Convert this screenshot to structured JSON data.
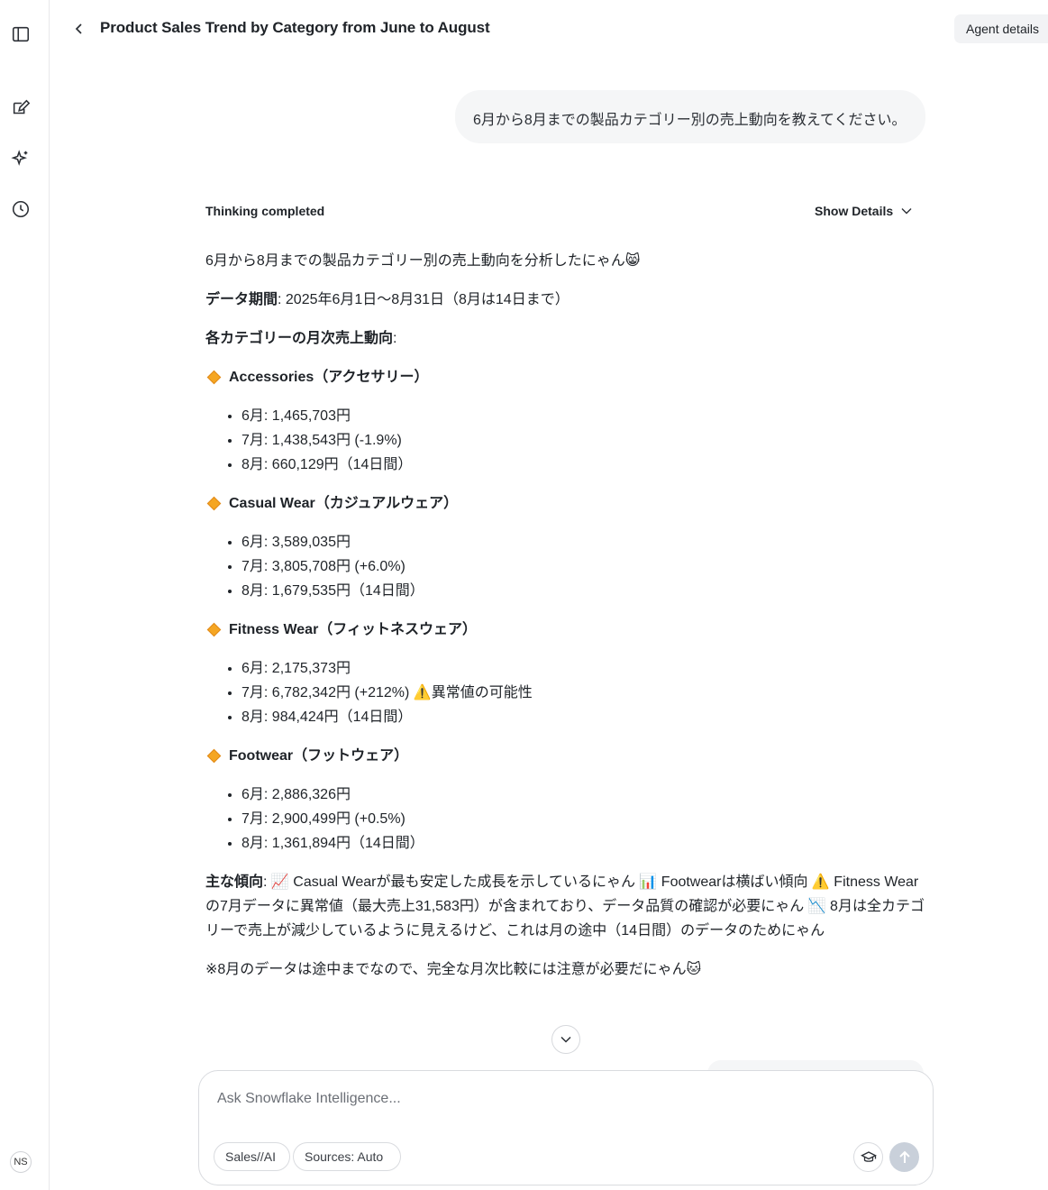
{
  "header": {
    "title": "Product Sales Trend by Category from June to August",
    "agent_details_label": "Agent details"
  },
  "sidebar": {
    "icons": [
      "sidebar-toggle-icon",
      "new-chat-icon",
      "sparkle-icon",
      "history-icon"
    ],
    "avatar_initials": "NS"
  },
  "conversation": {
    "user_message": "6月から8月までの製品カテゴリー別の売上動向を教えてください。",
    "thinking_status": "Thinking completed",
    "show_details_label": "Show Details",
    "answer": {
      "intro": "6月から8月までの製品カテゴリー別の売上動向を分析したにゃん😸",
      "period_label": "データ期間",
      "period_value": ": 2025年6月1日〜8月31日（8月は14日まで）",
      "monthly_label": "各カテゴリーの月次売上動向",
      "monthly_suffix": ":",
      "categories": [
        {
          "name": "Accessories（アクセサリー）",
          "items": [
            "6月: 1,465,703円",
            "7月: 1,438,543円 (-1.9%)",
            "8月: 660,129円（14日間）"
          ]
        },
        {
          "name": "Casual Wear（カジュアルウェア）",
          "items": [
            "6月: 3,589,035円",
            "7月: 3,805,708円 (+6.0%)",
            "8月: 1,679,535円（14日間）"
          ]
        },
        {
          "name": "Fitness Wear（フィットネスウェア）",
          "items": [
            "6月: 2,175,373円",
            "7月: 6,782,342円 (+212%) ⚠️異常値の可能性",
            "8月: 984,424円（14日間）"
          ]
        },
        {
          "name": "Footwear（フットウェア）",
          "items": [
            "6月: 2,886,326円",
            "7月: 2,900,499円 (+0.5%)",
            "8月: 1,361,894円（14日間）"
          ]
        }
      ],
      "trends_label": "主な傾向",
      "trends_text": ": 📈 Casual Wearが最も安定した成長を示しているにゃん 📊 Footwearは横ばい傾向 ⚠️ Fitness Wearの7月データに異常値（最大売上31,583円）が含まれており、データ品質の確認が必要にゃん 📉 8月は全カテゴリーで売上が減少しているように見えるけど、これは月の途中（14日間）のデータのためにゃん",
      "note": "※8月のデータは途中までなので、完全な月次比較には注意が必要だにゃん🐱"
    }
  },
  "composer": {
    "placeholder": "Ask Snowflake Intelligence...",
    "agent_chip": "Sales//AI",
    "sources_chip": "Sources: Auto"
  }
}
